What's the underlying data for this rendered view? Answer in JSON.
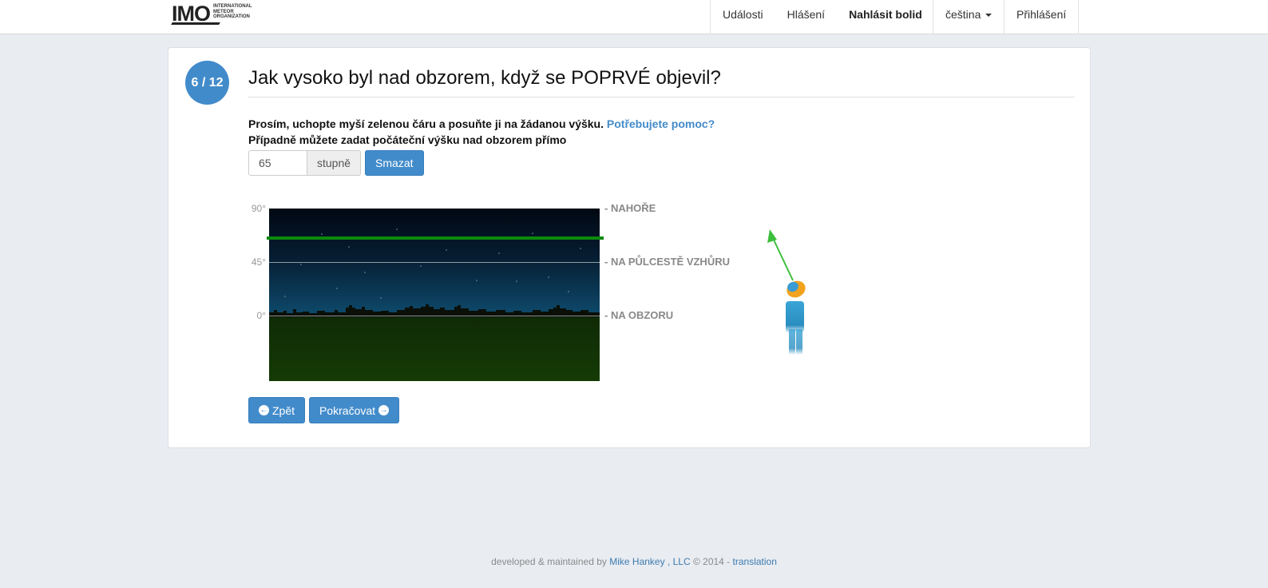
{
  "logo": {
    "mark": "IMO",
    "line1": "INTERNATIONAL",
    "line2": "METEOR",
    "line3": "ORGANIZATION"
  },
  "nav": {
    "events": "Události",
    "reports": "Hlášení",
    "report_fireball": "Nahlásit bolid",
    "language": "čeština",
    "login": "Přihlášení"
  },
  "step": {
    "label": "6 / 12"
  },
  "question": "Jak vysoko byl nad obzorem, když se POPRVÉ objevil?",
  "instructions": {
    "line1": "Prosím, uchopte myší zelenou čáru a posuňte ji na žádanou výšku.",
    "help_link": "Potřebujete pomoc?",
    "line2": "Případně můžete zadat počáteční výšku nad obzorem přímo"
  },
  "altitude": {
    "value": "65",
    "unit": "stupně",
    "clear_label": "Smazat"
  },
  "sky": {
    "deg_90": "90°",
    "deg_45": "45°",
    "deg_0": "0°",
    "label_top": "NAHOŘE",
    "label_mid": "NA PŮLCESTĚ VZHŮRU",
    "label_horizon": "NA OBZORU",
    "selected_altitude_deg": 65
  },
  "buttons": {
    "back": "Zpět",
    "continue": "Pokračovat"
  },
  "footer": {
    "prefix": "developed & maintained by",
    "author": "Mike Hankey",
    "company": ", LLC",
    "copyright": "© 2014 -",
    "translation": "translation"
  }
}
